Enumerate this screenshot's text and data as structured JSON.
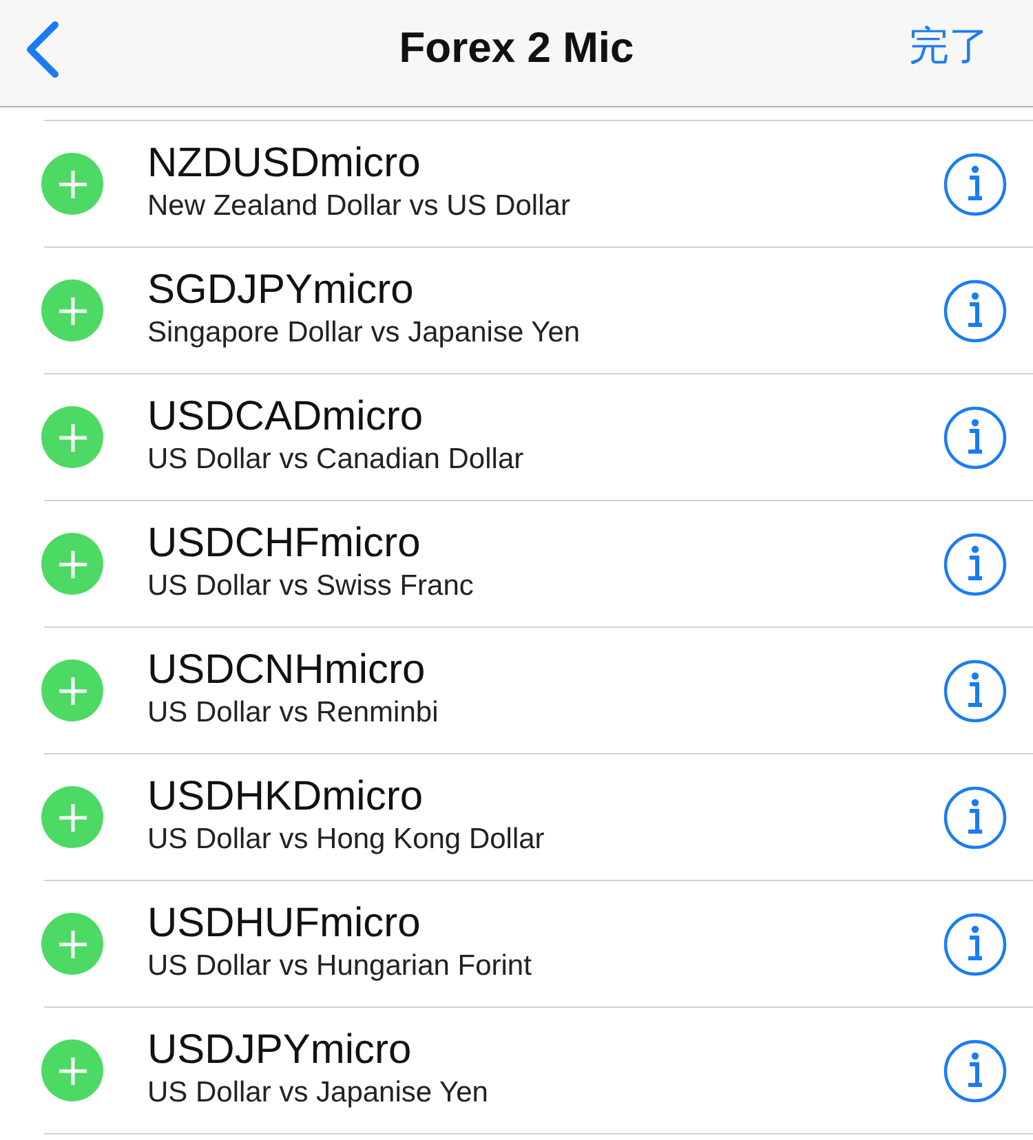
{
  "nav": {
    "title": "Forex 2 Mic",
    "done": "完了"
  },
  "rows": [
    {
      "symbol": "NZDUSDmicro",
      "description": "New Zealand Dollar vs US Dollar"
    },
    {
      "symbol": "SGDJPYmicro",
      "description": "Singapore Dollar vs Japanise Yen"
    },
    {
      "symbol": "USDCADmicro",
      "description": "US Dollar vs Canadian Dollar"
    },
    {
      "symbol": "USDCHFmicro",
      "description": "US Dollar vs Swiss Franc"
    },
    {
      "symbol": "USDCNHmicro",
      "description": "US Dollar vs Renminbi"
    },
    {
      "symbol": "USDHKDmicro",
      "description": "US Dollar vs Hong Kong Dollar"
    },
    {
      "symbol": "USDHUFmicro",
      "description": "US Dollar vs Hungarian Forint"
    },
    {
      "symbol": "USDJPYmicro",
      "description": "US Dollar vs Japanise Yen"
    }
  ]
}
